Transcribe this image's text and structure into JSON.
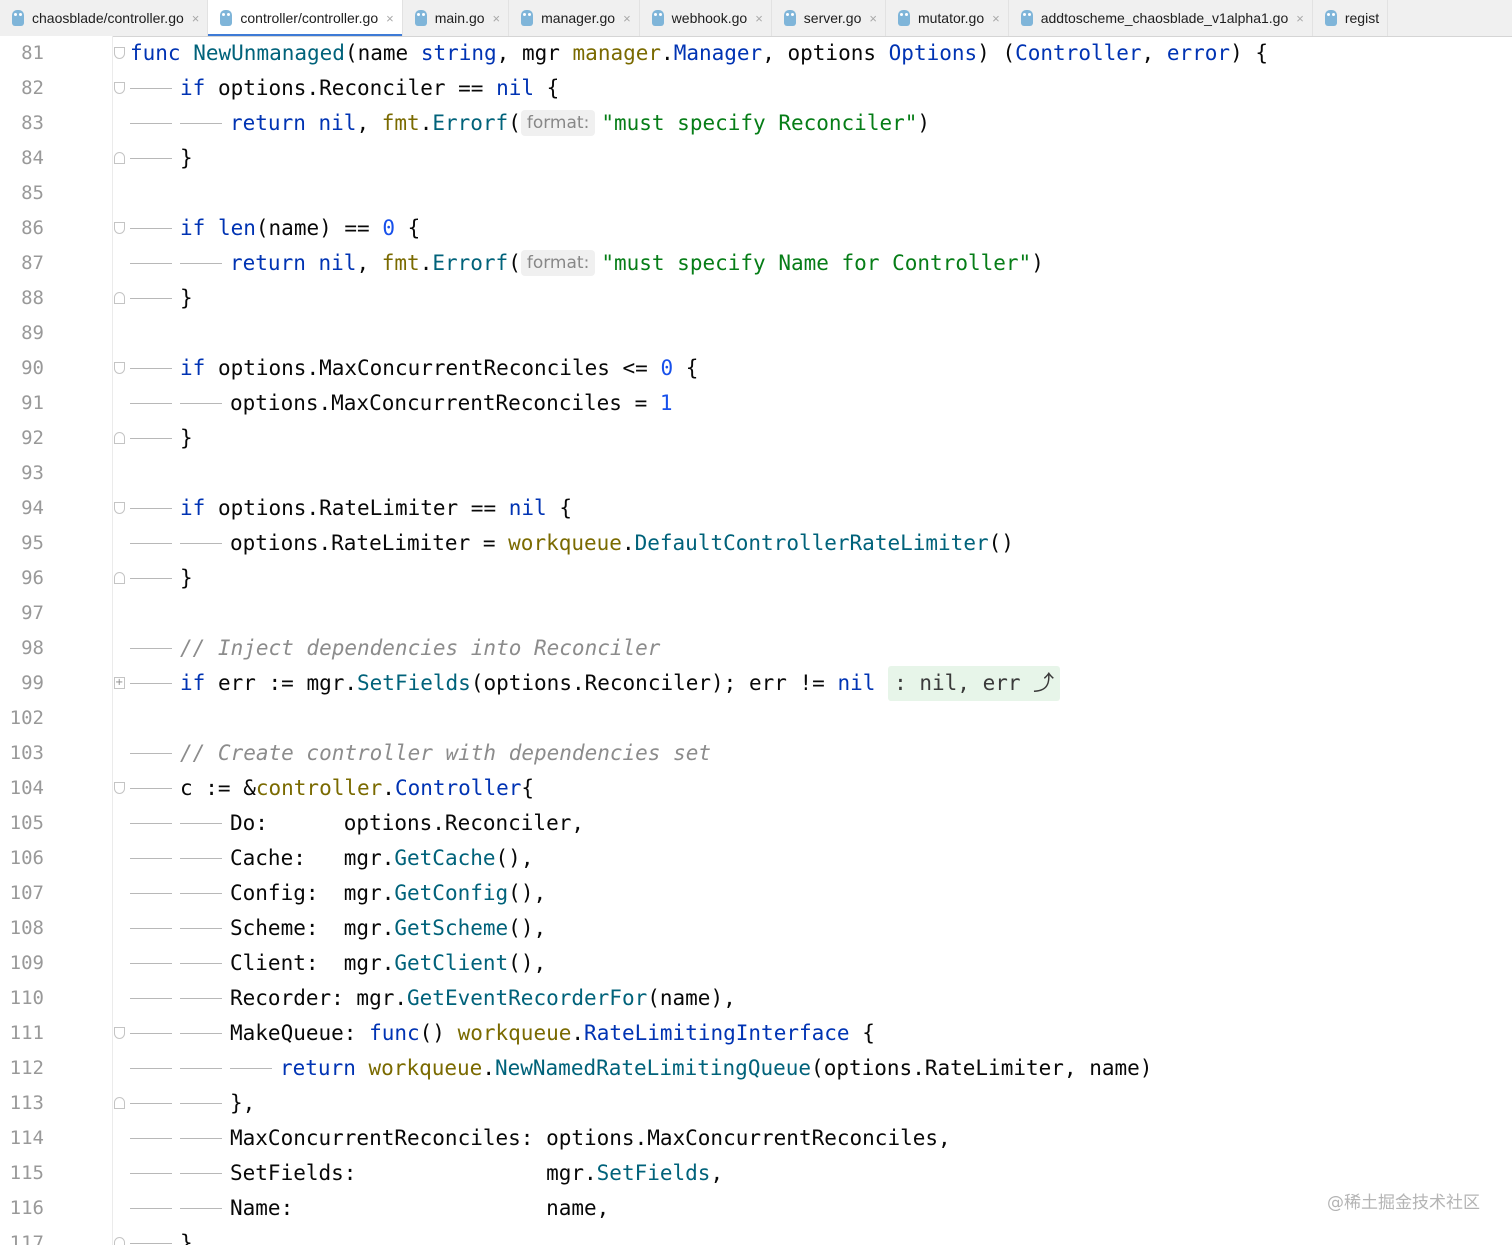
{
  "tabs": [
    {
      "label": "chaosblade/controller.go",
      "active": false,
      "closable": true
    },
    {
      "label": "controller/controller.go",
      "active": true,
      "closable": true
    },
    {
      "label": "main.go",
      "active": false,
      "closable": true
    },
    {
      "label": "manager.go",
      "active": false,
      "closable": true
    },
    {
      "label": "webhook.go",
      "active": false,
      "closable": true
    },
    {
      "label": "server.go",
      "active": false,
      "closable": true
    },
    {
      "label": "mutator.go",
      "active": false,
      "closable": true
    },
    {
      "label": "addtoscheme_chaosblade_v1alpha1.go",
      "active": false,
      "closable": true
    },
    {
      "label": "regist",
      "active": false,
      "closable": false
    }
  ],
  "tab_icon": "go-gopher-icon",
  "editor": {
    "param_hint_label": "format:",
    "lines": [
      {
        "n": "81",
        "fold": "open",
        "guides": 0,
        "tokens": [
          [
            "func",
            "kw"
          ],
          [
            " "
          ],
          [
            "NewUnmanaged",
            "fnname"
          ],
          [
            "(name "
          ],
          [
            "string",
            "typ"
          ],
          [
            ", mgr "
          ],
          [
            "manager",
            "pkg"
          ],
          [
            "."
          ],
          [
            "Manager",
            "typ"
          ],
          [
            ", options "
          ],
          [
            "Options",
            "typ"
          ],
          [
            ") ("
          ],
          [
            "Controller",
            "typ"
          ],
          [
            ", "
          ],
          [
            "error",
            "typ"
          ],
          [
            ") {"
          ]
        ]
      },
      {
        "n": "82",
        "fold": "open",
        "guides": 1,
        "tokens": [
          [
            "if",
            "kw"
          ],
          [
            " options.Reconciler == "
          ],
          [
            "nil",
            "kw"
          ],
          [
            " {"
          ]
        ]
      },
      {
        "n": "83",
        "fold": "",
        "guides": 2,
        "tokens": [
          [
            "return",
            "kw"
          ],
          [
            " "
          ],
          [
            "nil",
            "kw"
          ],
          [
            ", "
          ],
          [
            "fmt",
            "pkg"
          ],
          [
            "."
          ],
          [
            "Errorf",
            "call"
          ],
          [
            "("
          ],
          [
            "format:",
            "hint"
          ],
          [
            "\"must specify Reconciler\"",
            "str"
          ],
          [
            ")"
          ]
        ]
      },
      {
        "n": "84",
        "fold": "close",
        "guides": 1,
        "tokens": [
          [
            "}"
          ]
        ]
      },
      {
        "n": "85",
        "fold": "",
        "guides": 0,
        "tokens": []
      },
      {
        "n": "86",
        "fold": "open",
        "guides": 1,
        "tokens": [
          [
            "if",
            "kw"
          ],
          [
            " "
          ],
          [
            "len",
            "kw"
          ],
          [
            "(name) == "
          ],
          [
            "0",
            "num"
          ],
          [
            " {"
          ]
        ]
      },
      {
        "n": "87",
        "fold": "",
        "guides": 2,
        "tokens": [
          [
            "return",
            "kw"
          ],
          [
            " "
          ],
          [
            "nil",
            "kw"
          ],
          [
            ", "
          ],
          [
            "fmt",
            "pkg"
          ],
          [
            "."
          ],
          [
            "Errorf",
            "call"
          ],
          [
            "("
          ],
          [
            "format:",
            "hint"
          ],
          [
            "\"must specify Name for Controller\"",
            "str"
          ],
          [
            ")"
          ]
        ]
      },
      {
        "n": "88",
        "fold": "close",
        "guides": 1,
        "tokens": [
          [
            "}"
          ]
        ]
      },
      {
        "n": "89",
        "fold": "",
        "guides": 0,
        "tokens": []
      },
      {
        "n": "90",
        "fold": "open",
        "guides": 1,
        "tokens": [
          [
            "if",
            "kw"
          ],
          [
            " options.MaxConcurrentReconciles <= "
          ],
          [
            "0",
            "num"
          ],
          [
            " {"
          ]
        ]
      },
      {
        "n": "91",
        "fold": "",
        "guides": 2,
        "tokens": [
          [
            "options.MaxConcurrentReconciles = "
          ],
          [
            "1",
            "num"
          ]
        ]
      },
      {
        "n": "92",
        "fold": "close",
        "guides": 1,
        "tokens": [
          [
            "}"
          ]
        ]
      },
      {
        "n": "93",
        "fold": "",
        "guides": 0,
        "tokens": []
      },
      {
        "n": "94",
        "fold": "open",
        "guides": 1,
        "tokens": [
          [
            "if",
            "kw"
          ],
          [
            " options.RateLimiter == "
          ],
          [
            "nil",
            "kw"
          ],
          [
            " {"
          ]
        ]
      },
      {
        "n": "95",
        "fold": "",
        "guides": 2,
        "tokens": [
          [
            "options.RateLimiter = "
          ],
          [
            "workqueue",
            "pkg"
          ],
          [
            "."
          ],
          [
            "DefaultControllerRateLimiter",
            "call"
          ],
          [
            "()"
          ]
        ]
      },
      {
        "n": "96",
        "fold": "close",
        "guides": 1,
        "tokens": [
          [
            "}"
          ]
        ]
      },
      {
        "n": "97",
        "fold": "",
        "guides": 0,
        "tokens": []
      },
      {
        "n": "98",
        "fold": "",
        "guides": 1,
        "tokens": [
          [
            "// Inject dependencies into Reconciler",
            "cmt"
          ]
        ]
      },
      {
        "n": "99",
        "fold": "plus",
        "guides": 1,
        "tokens": [
          [
            "if",
            "kw"
          ],
          [
            " err := mgr."
          ],
          [
            "SetFields",
            "call"
          ],
          [
            "(options.Reconciler); err != "
          ],
          [
            "nil",
            "kw"
          ],
          [
            " "
          ],
          [
            ": nil, err ⤴",
            "folded"
          ]
        ]
      },
      {
        "n": "102",
        "fold": "",
        "guides": 0,
        "tokens": []
      },
      {
        "n": "103",
        "fold": "",
        "guides": 1,
        "tokens": [
          [
            "// Create controller with dependencies set",
            "cmt"
          ]
        ]
      },
      {
        "n": "104",
        "fold": "open",
        "guides": 1,
        "tokens": [
          [
            "c := &"
          ],
          [
            "controller",
            "pkg"
          ],
          [
            "."
          ],
          [
            "Controller",
            "typ"
          ],
          [
            "{"
          ]
        ]
      },
      {
        "n": "105",
        "fold": "",
        "guides": 2,
        "tokens": [
          [
            "Do:      options.Reconciler,"
          ]
        ]
      },
      {
        "n": "106",
        "fold": "",
        "guides": 2,
        "tokens": [
          [
            "Cache:   mgr."
          ],
          [
            "GetCache",
            "call"
          ],
          [
            "(),"
          ]
        ]
      },
      {
        "n": "107",
        "fold": "",
        "guides": 2,
        "tokens": [
          [
            "Config:  mgr."
          ],
          [
            "GetConfig",
            "call"
          ],
          [
            "(),"
          ]
        ]
      },
      {
        "n": "108",
        "fold": "",
        "guides": 2,
        "tokens": [
          [
            "Scheme:  mgr."
          ],
          [
            "GetScheme",
            "call"
          ],
          [
            "(),"
          ]
        ]
      },
      {
        "n": "109",
        "fold": "",
        "guides": 2,
        "tokens": [
          [
            "Client:  mgr."
          ],
          [
            "GetClient",
            "call"
          ],
          [
            "(),"
          ]
        ]
      },
      {
        "n": "110",
        "fold": "",
        "guides": 2,
        "tokens": [
          [
            "Recorder: mgr."
          ],
          [
            "GetEventRecorderFor",
            "call"
          ],
          [
            "(name),"
          ]
        ]
      },
      {
        "n": "111",
        "fold": "open",
        "guides": 2,
        "tokens": [
          [
            "MakeQueue: "
          ],
          [
            "func",
            "kw"
          ],
          [
            "() "
          ],
          [
            "workqueue",
            "pkg"
          ],
          [
            "."
          ],
          [
            "RateLimitingInterface",
            "typ"
          ],
          [
            " {"
          ]
        ]
      },
      {
        "n": "112",
        "fold": "",
        "guides": 3,
        "tokens": [
          [
            "return",
            "kw"
          ],
          [
            " "
          ],
          [
            "workqueue",
            "pkg"
          ],
          [
            "."
          ],
          [
            "NewNamedRateLimitingQueue",
            "call"
          ],
          [
            "(options.RateLimiter, name)"
          ]
        ]
      },
      {
        "n": "113",
        "fold": "close",
        "guides": 2,
        "tokens": [
          [
            "},"
          ]
        ]
      },
      {
        "n": "114",
        "fold": "",
        "guides": 2,
        "tokens": [
          [
            "MaxConcurrentReconciles: options.MaxConcurrentReconciles,"
          ]
        ]
      },
      {
        "n": "115",
        "fold": "",
        "guides": 2,
        "tokens": [
          [
            "SetFields:               mgr."
          ],
          [
            "SetFields",
            "call"
          ],
          [
            ","
          ]
        ]
      },
      {
        "n": "116",
        "fold": "",
        "guides": 2,
        "tokens": [
          [
            "Name:                    name,"
          ]
        ]
      },
      {
        "n": "117",
        "fold": "close",
        "guides": 1,
        "tokens": [
          [
            "}"
          ]
        ]
      }
    ]
  },
  "watermark": "@稀土掘金技术社区"
}
